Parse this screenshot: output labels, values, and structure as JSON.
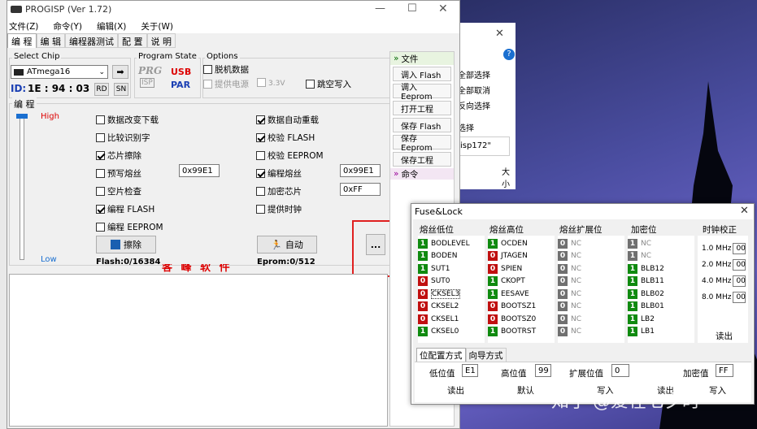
{
  "desktop_bg": {
    "side_texts": [
      "全部选择",
      "全部取消",
      "反向选择",
      "选择",
      "isp172\"",
      "大小"
    ],
    "watermark": "知乎 @爱在七夕时"
  },
  "progisp": {
    "title": "PROGISP (Ver 1.72)",
    "menu": [
      "文件(Z)",
      "命令(Y)",
      "编辑(X)",
      "关于(W)"
    ],
    "tabs": [
      "编 程",
      "编 辑",
      "编程器测试",
      "配 置",
      "说 明"
    ],
    "chip": {
      "legend": "Select Chip",
      "value": "ATmega16",
      "id_label": "ID:",
      "id_value": "1E : 94 : 03",
      "rd": "RD",
      "sn": "SN"
    },
    "program_state": {
      "legend": "Program State",
      "prg": "PRG",
      "isp": "ISP",
      "usb": "USB",
      "par": "PAR"
    },
    "options": {
      "legend": "Options",
      "offline": "脱机数据",
      "supply_power": "提供电源",
      "voltage": "3.3V",
      "jump_write": "跳空写入"
    },
    "prog": {
      "legend": "编 程",
      "high": "High",
      "low": "Low",
      "left": [
        "数据改变下载",
        "比较识别字",
        "芯片擦除",
        "预写熔丝",
        "空片检查",
        "编程 FLASH",
        "编程 EEPROM"
      ],
      "left_checked": [
        false,
        false,
        true,
        false,
        false,
        true,
        false
      ],
      "right": [
        "数据自动重载",
        "校验 FLASH",
        "校验 EEPROM",
        "编程熔丝",
        "加密芯片",
        "提供时钟"
      ],
      "right_checked": [
        true,
        true,
        false,
        true,
        false,
        false
      ],
      "prewrite_fuse_value": "0x99E1",
      "fuse_value": "0x99E1",
      "lock_value": "0xFF",
      "erase_btn": "擦除",
      "auto_btn": "自动",
      "more_btn": "...",
      "flash": "Flash:0/16384",
      "eprom": "Eprom:0/512",
      "banner": "客 峰 软 件"
    },
    "cmd": {
      "file_header": "文件",
      "buttons": [
        "调入 Flash",
        "调入 Eeprom",
        "打开工程",
        "保存 Flash",
        "保存 Eeprom",
        "保存工程"
      ],
      "cmd_header": "命令"
    }
  },
  "back_dialog": {
    "close": "✕",
    "help": "?"
  },
  "fuse": {
    "title": "Fuse&Lock",
    "headers": [
      "熔丝低位",
      "熔丝高位",
      "熔丝扩展位",
      "加密位",
      "时钟校正"
    ],
    "low": [
      {
        "v": "1",
        "n": "BODLEVEL"
      },
      {
        "v": "1",
        "n": "BODEN"
      },
      {
        "v": "1",
        "n": "SUT1"
      },
      {
        "v": "0",
        "n": "SUT0"
      },
      {
        "v": "0",
        "n": "CKSEL3"
      },
      {
        "v": "0",
        "n": "CKSEL2"
      },
      {
        "v": "0",
        "n": "CKSEL1"
      },
      {
        "v": "1",
        "n": "CKSEL0"
      }
    ],
    "high": [
      {
        "v": "1",
        "n": "OCDEN"
      },
      {
        "v": "0",
        "n": "JTAGEN"
      },
      {
        "v": "0",
        "n": "SPIEN"
      },
      {
        "v": "1",
        "n": "CKOPT"
      },
      {
        "v": "1",
        "n": "EESAVE"
      },
      {
        "v": "0",
        "n": "BOOTSZ1"
      },
      {
        "v": "0",
        "n": "BOOTSZ0"
      },
      {
        "v": "1",
        "n": "BOOTRST"
      }
    ],
    "ext": [
      {
        "v": "0",
        "n": "NC"
      },
      {
        "v": "0",
        "n": "NC"
      },
      {
        "v": "0",
        "n": "NC"
      },
      {
        "v": "0",
        "n": "NC"
      },
      {
        "v": "0",
        "n": "NC"
      },
      {
        "v": "0",
        "n": "NC"
      },
      {
        "v": "0",
        "n": "NC"
      },
      {
        "v": "0",
        "n": "NC"
      }
    ],
    "lock": [
      {
        "v": "1",
        "n": "NC"
      },
      {
        "v": "1",
        "n": "NC"
      },
      {
        "v": "1",
        "n": "BLB12"
      },
      {
        "v": "1",
        "n": "BLB11"
      },
      {
        "v": "1",
        "n": "BLB02"
      },
      {
        "v": "1",
        "n": "BLB01"
      },
      {
        "v": "1",
        "n": "LB2"
      },
      {
        "v": "1",
        "n": "LB1"
      }
    ],
    "clock": [
      {
        "f": "1.0 MHz",
        "v": "00"
      },
      {
        "f": "2.0 MHz",
        "v": "00"
      },
      {
        "f": "4.0 MHz",
        "v": "00"
      },
      {
        "f": "8.0 MHz",
        "v": "00"
      }
    ],
    "clock_read": "读出",
    "tabs": [
      "位配置方式",
      "向导方式"
    ],
    "low_label": "低位值",
    "low_value": "E1",
    "high_label": "高位值",
    "high_value": "99",
    "ext_label": "扩展位值",
    "ext_value": "0",
    "lock_label": "加密值",
    "lock_value": "FF",
    "read_btn": "读出",
    "default_btn": "默认",
    "write_btn": "写入",
    "read_btn2": "读出",
    "write_btn2": "写入"
  }
}
